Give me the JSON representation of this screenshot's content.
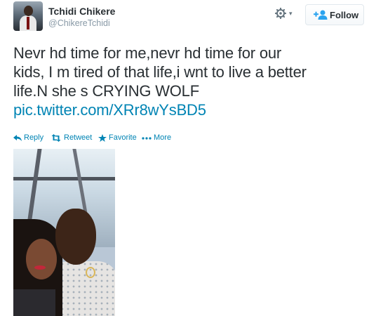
{
  "user": {
    "fullname": "Tchidi Chikere",
    "username": "@ChikereTchidi"
  },
  "header": {
    "settings_icon": "gear-icon",
    "caret_icon": "chevron-down-icon",
    "follow_label": "Follow",
    "follow_icon": "add-user-icon"
  },
  "tweet": {
    "text_line1": "Nevr hd time for me,nevr hd time for our",
    "text_line2": "kids, I m tired of that life,i wnt to live a better",
    "text_line3": "life.N she s CRYING WOLF",
    "link": "pic.twitter.com/XRr8wYsBD5"
  },
  "actions": [
    {
      "label": "Reply",
      "icon": "reply-icon"
    },
    {
      "label": "Retweet",
      "icon": "retweet-icon"
    },
    {
      "label": "Favorite",
      "icon": "star-icon"
    },
    {
      "label": "More",
      "icon": "more-icon"
    }
  ],
  "colors": {
    "link": "#0084b4",
    "text": "#292f33",
    "muted": "#8899a6",
    "follow_icon": "#2aa3ef"
  }
}
